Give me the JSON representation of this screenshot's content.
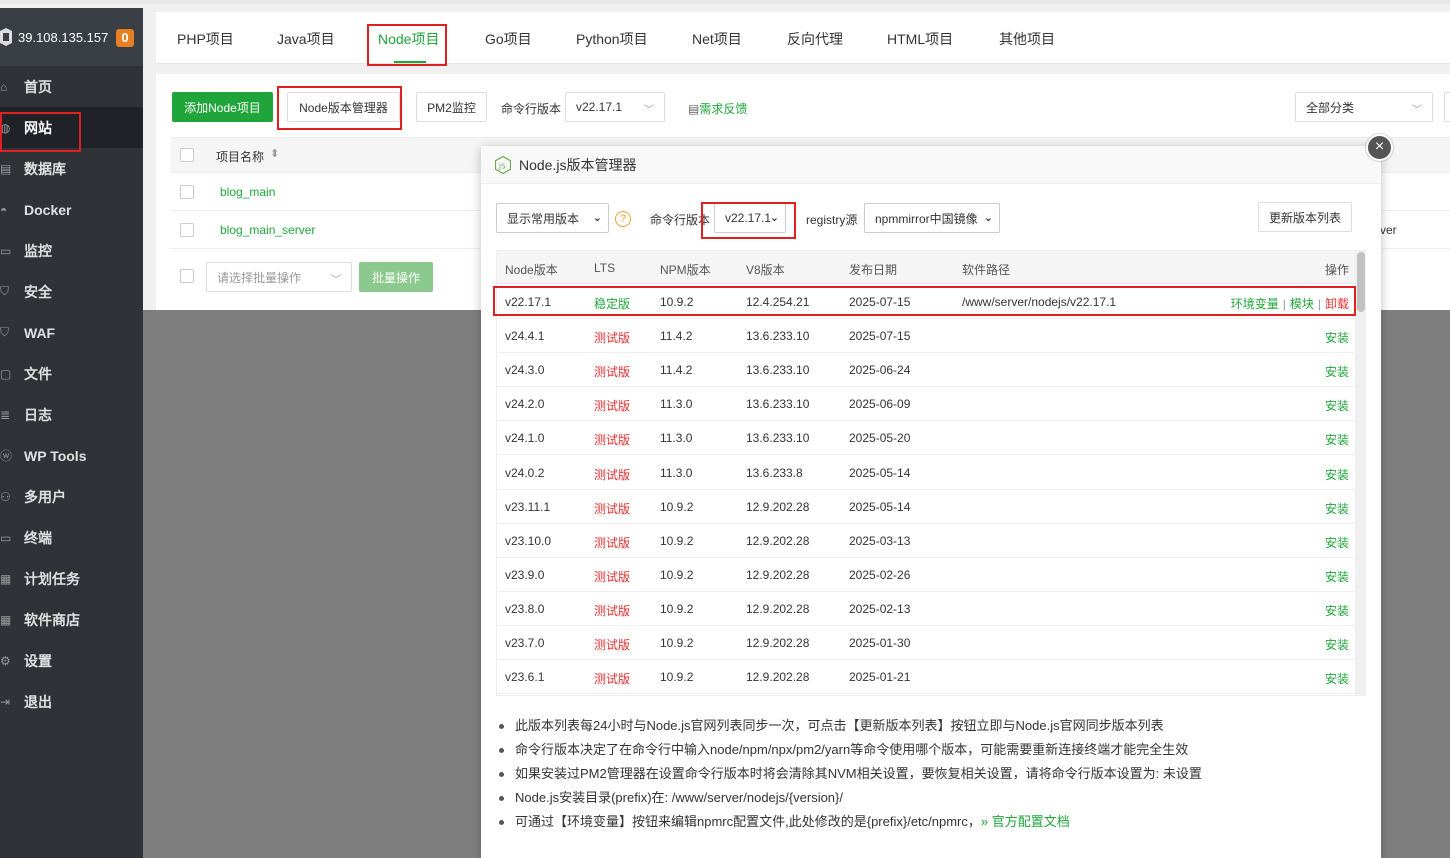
{
  "sidebar": {
    "server_ip": "39.108.135.157",
    "badge_count": "0",
    "items": [
      {
        "label": "首页",
        "icon": "home-icon"
      },
      {
        "label": "网站",
        "icon": "globe-icon"
      },
      {
        "label": "数据库",
        "icon": "database-icon"
      },
      {
        "label": "Docker",
        "icon": "docker-icon"
      },
      {
        "label": "监控",
        "icon": "monitor-icon"
      },
      {
        "label": "安全",
        "icon": "shield-icon"
      },
      {
        "label": "WAF",
        "icon": "waf-shield-icon"
      },
      {
        "label": "文件",
        "icon": "folder-icon"
      },
      {
        "label": "日志",
        "icon": "log-icon"
      },
      {
        "label": "WP Tools",
        "icon": "wordpress-icon"
      },
      {
        "label": "多用户",
        "icon": "users-icon"
      },
      {
        "label": "终端",
        "icon": "terminal-icon"
      },
      {
        "label": "计划任务",
        "icon": "calendar-icon"
      },
      {
        "label": "软件商店",
        "icon": "grid-icon"
      },
      {
        "label": "设置",
        "icon": "gear-icon"
      },
      {
        "label": "退出",
        "icon": "logout-icon"
      }
    ]
  },
  "tabs": [
    "PHP项目",
    "Java项目",
    "Node项目",
    "Go项目",
    "Python项目",
    "Net项目",
    "反向代理",
    "HTML项目",
    "其他项目"
  ],
  "toolbar": {
    "add_node": "添加Node项目",
    "version_manager": "Node版本管理器",
    "pm2": "PM2监控",
    "cli_label": "命令行版本",
    "cli_value": "v22.17.1",
    "feedback": "需求反馈",
    "category": "全部分类"
  },
  "project_table": {
    "col_name": "项目名称",
    "rows": [
      "blog_main",
      "blog_main_server"
    ],
    "right_clip": "ver",
    "batch_placeholder": "请选择批量操作",
    "batch_button": "批量操作"
  },
  "modal": {
    "title": "Node.js版本管理器",
    "filter_value": "显示常用版本",
    "cli_label": "命令行版本",
    "cli_value": "v22.17.1",
    "registry_label": "registry源",
    "registry_value": "npmmirror中国镜像",
    "update_button": "更新版本列表",
    "close": "×",
    "headers": [
      "Node版本",
      "LTS",
      "NPM版本",
      "V8版本",
      "发布日期",
      "软件路径",
      "操作"
    ],
    "rows": [
      {
        "ver": "v22.17.1",
        "lts": "稳定版",
        "npm": "10.9.2",
        "v8": "12.4.254.21",
        "date": "2025-07-15",
        "path": "/www/server/nodejs/v22.17.1",
        "installed": true
      },
      {
        "ver": "v24.4.1",
        "lts": "测试版",
        "npm": "11.4.2",
        "v8": "13.6.233.10",
        "date": "2025-07-15",
        "path": "",
        "installed": false
      },
      {
        "ver": "v24.3.0",
        "lts": "测试版",
        "npm": "11.4.2",
        "v8": "13.6.233.10",
        "date": "2025-06-24",
        "path": "",
        "installed": false
      },
      {
        "ver": "v24.2.0",
        "lts": "测试版",
        "npm": "11.3.0",
        "v8": "13.6.233.10",
        "date": "2025-06-09",
        "path": "",
        "installed": false
      },
      {
        "ver": "v24.1.0",
        "lts": "测试版",
        "npm": "11.3.0",
        "v8": "13.6.233.10",
        "date": "2025-05-20",
        "path": "",
        "installed": false
      },
      {
        "ver": "v24.0.2",
        "lts": "测试版",
        "npm": "11.3.0",
        "v8": "13.6.233.8",
        "date": "2025-05-14",
        "path": "",
        "installed": false
      },
      {
        "ver": "v23.11.1",
        "lts": "测试版",
        "npm": "10.9.2",
        "v8": "12.9.202.28",
        "date": "2025-05-14",
        "path": "",
        "installed": false
      },
      {
        "ver": "v23.10.0",
        "lts": "测试版",
        "npm": "10.9.2",
        "v8": "12.9.202.28",
        "date": "2025-03-13",
        "path": "",
        "installed": false
      },
      {
        "ver": "v23.9.0",
        "lts": "测试版",
        "npm": "10.9.2",
        "v8": "12.9.202.28",
        "date": "2025-02-26",
        "path": "",
        "installed": false
      },
      {
        "ver": "v23.8.0",
        "lts": "测试版",
        "npm": "10.9.2",
        "v8": "12.9.202.28",
        "date": "2025-02-13",
        "path": "",
        "installed": false
      },
      {
        "ver": "v23.7.0",
        "lts": "测试版",
        "npm": "10.9.2",
        "v8": "12.9.202.28",
        "date": "2025-01-30",
        "path": "",
        "installed": false
      },
      {
        "ver": "v23.6.1",
        "lts": "测试版",
        "npm": "10.9.2",
        "v8": "12.9.202.28",
        "date": "2025-01-21",
        "path": "",
        "installed": false
      }
    ],
    "actions": {
      "env": "环境变量",
      "module": "模块",
      "uninstall": "卸载",
      "install": "安装",
      "sep": "|"
    },
    "notes": [
      "此版本列表每24小时与Node.js官网列表同步一次，可点击【更新版本列表】按钮立即与Node.js官网同步版本列表",
      "命令行版本决定了在命令行中输入node/npm/npx/pm2/yarn等命令使用哪个版本，可能需要重新连接终端才能完全生效",
      "如果安装过PM2管理器在设置命令行版本时将会清除其NVM相关设置，要恢复相关设置，请将命令行版本设置为: 未设置",
      "Node.js安装目录(prefix)在: /www/server/nodejs/{version}/",
      "可通过【环境变量】按钮来编辑npmrc配置文件,此处修改的是{prefix}/etc/npmrc，"
    ],
    "docs_link": "官方配置文档"
  },
  "colors": {
    "accent": "#20a53a",
    "danger": "#e03030",
    "sidebar": "#2f3338",
    "highlight": "#e02020"
  }
}
